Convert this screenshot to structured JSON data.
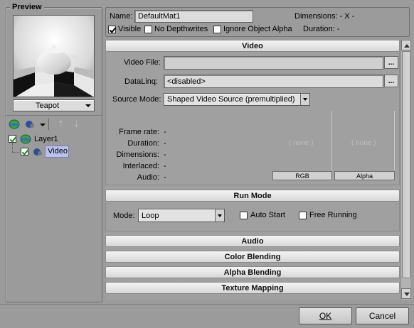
{
  "preview": {
    "title": "Preview",
    "object_select": "Teapot"
  },
  "tree": {
    "layer_label": "Layer1",
    "layer_checked": true,
    "video_label": "Video",
    "video_checked": true
  },
  "material": {
    "name_label": "Name:",
    "name_value": "DefaultMat1",
    "dimensions_label": "Dimensions: - X -",
    "visible_label": "Visible",
    "visible_checked": true,
    "no_depthwrites_label": "No Depthwrites",
    "no_depthwrites_checked": false,
    "ignore_alpha_label": "Ignore Object Alpha",
    "ignore_alpha_checked": false,
    "duration_label": "Duration: -"
  },
  "video_section": {
    "header": "Video",
    "video_file_label": "Video File:",
    "video_file_value": "",
    "browse_label": "...",
    "datalinq_label": "DataLinq:",
    "datalinq_value": "<disabled>",
    "source_mode_label": "Source Mode:",
    "source_mode_value": "Shaped Video Source (premultiplied)",
    "info": [
      {
        "label": "Frame rate:",
        "value": "-"
      },
      {
        "label": "Duration:",
        "value": "-"
      },
      {
        "label": "Dimensions:",
        "value": "-"
      },
      {
        "label": "Interlaced:",
        "value": "-"
      },
      {
        "label": "Audio:",
        "value": "-"
      }
    ],
    "rgb_none": "( none )",
    "alpha_none": "( none )",
    "rgb_tab": "RGB",
    "alpha_tab": "Alpha"
  },
  "run_mode": {
    "header": "Run Mode",
    "mode_label": "Mode:",
    "mode_value": "Loop",
    "auto_start_label": "Auto Start",
    "auto_start_checked": false,
    "free_running_label": "Free Running",
    "free_running_checked": false
  },
  "collapsed_sections": [
    "Audio",
    "Color Blending",
    "Alpha Blending",
    "Texture Mapping"
  ],
  "dialog": {
    "ok_label": "OK",
    "cancel_label": "Cancel"
  }
}
